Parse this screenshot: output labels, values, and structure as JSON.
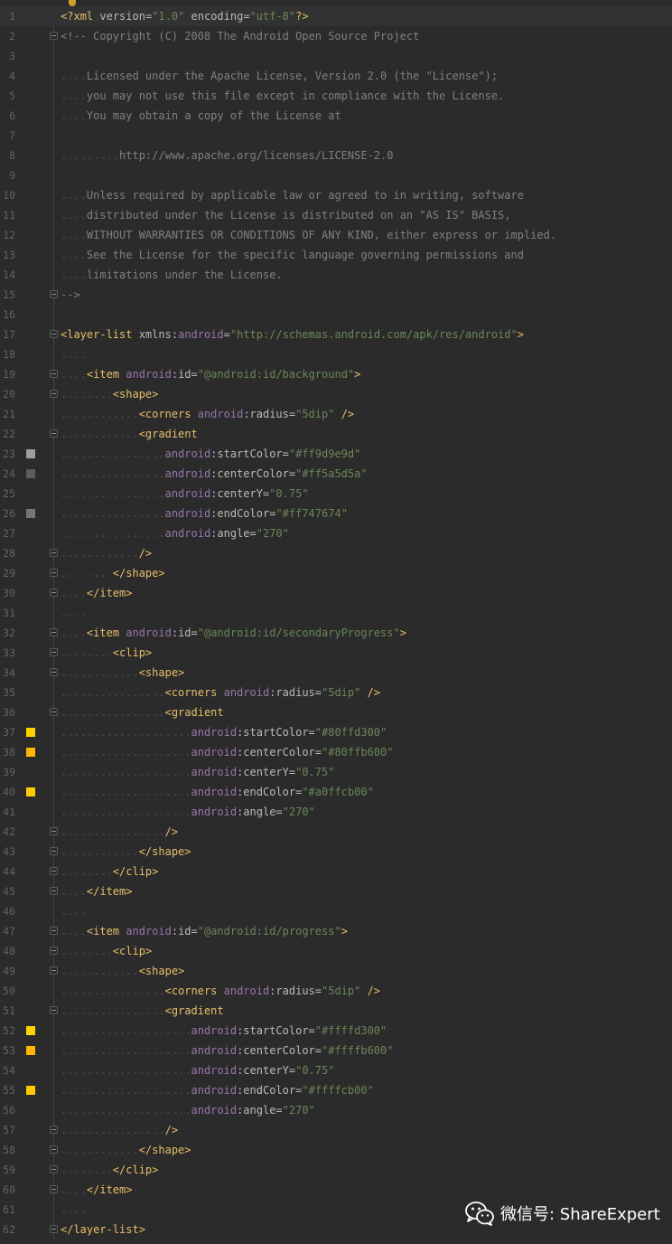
{
  "editor": {
    "swatch_colors": [
      "#9d9e9d",
      "#5a5d5a",
      "#747674",
      "#ffd300",
      "#ffb600",
      "#ffcb00"
    ],
    "lines": [
      {
        "no": "1",
        "segs": [
          [
            "pi",
            "<?"
          ],
          [
            "t",
            "xml"
          ],
          [
            "a",
            " version="
          ],
          [
            "s",
            "\"1.0\""
          ],
          [
            "a",
            " encoding="
          ],
          [
            "s",
            "\"utf-8\""
          ],
          [
            "pi",
            "?>"
          ]
        ]
      },
      {
        "no": "2",
        "fold": true,
        "segs": [
          [
            "c",
            "<!-- Copyright (C) 2008 The Android Open Source Project"
          ]
        ]
      },
      {
        "no": "3",
        "segs": []
      },
      {
        "no": "4",
        "segs": [
          [
            "d",
            "...."
          ],
          [
            "c",
            "Licensed under the Apache License, Version 2.0 (the \"License\");"
          ]
        ]
      },
      {
        "no": "5",
        "segs": [
          [
            "d",
            "...."
          ],
          [
            "c",
            "you may not use this file except in compliance with the License."
          ]
        ]
      },
      {
        "no": "6",
        "segs": [
          [
            "d",
            "...."
          ],
          [
            "c",
            "You may obtain a copy of the License at"
          ]
        ]
      },
      {
        "no": "7",
        "segs": []
      },
      {
        "no": "8",
        "segs": [
          [
            "d",
            "........."
          ],
          [
            "c",
            "http://www.apache.org/licenses/LICENSE-2.0"
          ]
        ]
      },
      {
        "no": "9",
        "segs": []
      },
      {
        "no": "10",
        "segs": [
          [
            "d",
            "...."
          ],
          [
            "c",
            "Unless required by applicable law or agreed to in writing, software"
          ]
        ]
      },
      {
        "no": "11",
        "segs": [
          [
            "d",
            "...."
          ],
          [
            "c",
            "distributed under the License is distributed on an \"AS IS\" BASIS,"
          ]
        ]
      },
      {
        "no": "12",
        "segs": [
          [
            "d",
            "...."
          ],
          [
            "c",
            "WITHOUT WARRANTIES OR CONDITIONS OF ANY KIND, either express or implied."
          ]
        ]
      },
      {
        "no": "13",
        "segs": [
          [
            "d",
            "...."
          ],
          [
            "c",
            "See the License for the specific language governing permissions and"
          ]
        ]
      },
      {
        "no": "14",
        "segs": [
          [
            "d",
            "...."
          ],
          [
            "c",
            "limitations under the License."
          ]
        ]
      },
      {
        "no": "15",
        "fold": true,
        "segs": [
          [
            "c",
            "-->"
          ]
        ]
      },
      {
        "no": "16",
        "segs": []
      },
      {
        "no": "17",
        "fold": true,
        "segs": [
          [
            "t",
            "<layer-list "
          ],
          [
            "a",
            "xmlns:"
          ],
          [
            "ns",
            "android"
          ],
          [
            "a",
            "="
          ],
          [
            "s",
            "\"http://schemas.android.com/apk/res/android\""
          ],
          [
            "t",
            ">"
          ]
        ]
      },
      {
        "no": "18",
        "segs": [
          [
            "d",
            "...."
          ]
        ]
      },
      {
        "no": "19",
        "fold": true,
        "segs": [
          [
            "d",
            "...."
          ],
          [
            "t",
            "<item "
          ],
          [
            "ns",
            "android"
          ],
          [
            "a",
            ":id="
          ],
          [
            "s",
            "\"@android:id/background\""
          ],
          [
            "t",
            ">"
          ]
        ]
      },
      {
        "no": "20",
        "fold": true,
        "segs": [
          [
            "d",
            "........"
          ],
          [
            "t",
            "<shape>"
          ]
        ]
      },
      {
        "no": "21",
        "segs": [
          [
            "d",
            "............"
          ],
          [
            "t",
            "<corners "
          ],
          [
            "ns",
            "android"
          ],
          [
            "a",
            ":radius="
          ],
          [
            "s",
            "\"5dip\""
          ],
          [
            "t",
            " />"
          ]
        ]
      },
      {
        "no": "22",
        "fold": true,
        "segs": [
          [
            "d",
            "............"
          ],
          [
            "t",
            "<gradient"
          ]
        ]
      },
      {
        "no": "23",
        "swatch": 0,
        "segs": [
          [
            "d",
            "................"
          ],
          [
            "ns",
            "android"
          ],
          [
            "a",
            ":startColor="
          ],
          [
            "s",
            "\"#ff9d9e9d\""
          ]
        ]
      },
      {
        "no": "24",
        "swatch": 1,
        "segs": [
          [
            "d",
            "................"
          ],
          [
            "ns",
            "android"
          ],
          [
            "a",
            ":centerColor="
          ],
          [
            "s",
            "\"#ff5a5d5a\""
          ]
        ]
      },
      {
        "no": "25",
        "segs": [
          [
            "d",
            "................"
          ],
          [
            "ns",
            "android"
          ],
          [
            "a",
            ":centerY="
          ],
          [
            "s",
            "\"0.75\""
          ]
        ]
      },
      {
        "no": "26",
        "swatch": 2,
        "segs": [
          [
            "d",
            "................"
          ],
          [
            "ns",
            "android"
          ],
          [
            "a",
            ":endColor="
          ],
          [
            "s",
            "\"#ff747674\""
          ]
        ]
      },
      {
        "no": "27",
        "segs": [
          [
            "d",
            "................"
          ],
          [
            "ns",
            "android"
          ],
          [
            "a",
            ":angle="
          ],
          [
            "s",
            "\"270\""
          ]
        ]
      },
      {
        "no": "28",
        "fold": true,
        "segs": [
          [
            "d",
            "............"
          ],
          [
            "t",
            "/>"
          ]
        ]
      },
      {
        "no": "29",
        "fold": true,
        "segs": [
          [
            "d",
            "........"
          ],
          [
            "t",
            "</shape>"
          ]
        ]
      },
      {
        "no": "30",
        "fold": true,
        "segs": [
          [
            "d",
            "...."
          ],
          [
            "t",
            "</item>"
          ]
        ]
      },
      {
        "no": "31",
        "segs": [
          [
            "d",
            "...."
          ]
        ]
      },
      {
        "no": "32",
        "fold": true,
        "segs": [
          [
            "d",
            "...."
          ],
          [
            "t",
            "<item "
          ],
          [
            "ns",
            "android"
          ],
          [
            "a",
            ":id="
          ],
          [
            "s",
            "\"@android:id/secondaryProgress\""
          ],
          [
            "t",
            ">"
          ]
        ]
      },
      {
        "no": "33",
        "fold": true,
        "segs": [
          [
            "d",
            "........"
          ],
          [
            "t",
            "<clip>"
          ]
        ]
      },
      {
        "no": "34",
        "fold": true,
        "segs": [
          [
            "d",
            "............"
          ],
          [
            "t",
            "<shape>"
          ]
        ]
      },
      {
        "no": "35",
        "segs": [
          [
            "d",
            "................"
          ],
          [
            "t",
            "<corners "
          ],
          [
            "ns",
            "android"
          ],
          [
            "a",
            ":radius="
          ],
          [
            "s",
            "\"5dip\""
          ],
          [
            "t",
            " />"
          ]
        ]
      },
      {
        "no": "36",
        "fold": true,
        "segs": [
          [
            "d",
            "................"
          ],
          [
            "t",
            "<gradient"
          ]
        ]
      },
      {
        "no": "37",
        "swatch": 3,
        "segs": [
          [
            "d",
            "...................."
          ],
          [
            "ns",
            "android"
          ],
          [
            "a",
            ":startColor="
          ],
          [
            "s",
            "\"#80ffd300\""
          ]
        ]
      },
      {
        "no": "38",
        "swatch": 4,
        "segs": [
          [
            "d",
            "...................."
          ],
          [
            "ns",
            "android"
          ],
          [
            "a",
            ":centerColor="
          ],
          [
            "s",
            "\"#80ffb600\""
          ]
        ]
      },
      {
        "no": "39",
        "segs": [
          [
            "d",
            "...................."
          ],
          [
            "ns",
            "android"
          ],
          [
            "a",
            ":centerY="
          ],
          [
            "s",
            "\"0.75\""
          ]
        ]
      },
      {
        "no": "40",
        "swatch": 5,
        "segs": [
          [
            "d",
            "...................."
          ],
          [
            "ns",
            "android"
          ],
          [
            "a",
            ":endColor="
          ],
          [
            "s",
            "\"#a0ffcb00\""
          ]
        ]
      },
      {
        "no": "41",
        "segs": [
          [
            "d",
            "...................."
          ],
          [
            "ns",
            "android"
          ],
          [
            "a",
            ":angle="
          ],
          [
            "s",
            "\"270\""
          ]
        ]
      },
      {
        "no": "42",
        "fold": true,
        "segs": [
          [
            "d",
            "................"
          ],
          [
            "t",
            "/>"
          ]
        ]
      },
      {
        "no": "43",
        "fold": true,
        "segs": [
          [
            "d",
            "............"
          ],
          [
            "t",
            "</shape>"
          ]
        ]
      },
      {
        "no": "44",
        "fold": true,
        "segs": [
          [
            "d",
            "........"
          ],
          [
            "t",
            "</clip>"
          ]
        ]
      },
      {
        "no": "45",
        "fold": true,
        "segs": [
          [
            "d",
            "...."
          ],
          [
            "t",
            "</item>"
          ]
        ]
      },
      {
        "no": "46",
        "segs": [
          [
            "d",
            "...."
          ]
        ]
      },
      {
        "no": "47",
        "fold": true,
        "segs": [
          [
            "d",
            "...."
          ],
          [
            "t",
            "<item "
          ],
          [
            "ns",
            "android"
          ],
          [
            "a",
            ":id="
          ],
          [
            "s",
            "\"@android:id/progress\""
          ],
          [
            "t",
            ">"
          ]
        ]
      },
      {
        "no": "48",
        "fold": true,
        "segs": [
          [
            "d",
            "........"
          ],
          [
            "t",
            "<clip>"
          ]
        ]
      },
      {
        "no": "49",
        "fold": true,
        "segs": [
          [
            "d",
            "............"
          ],
          [
            "t",
            "<shape>"
          ]
        ]
      },
      {
        "no": "50",
        "segs": [
          [
            "d",
            "................"
          ],
          [
            "t",
            "<corners "
          ],
          [
            "ns",
            "android"
          ],
          [
            "a",
            ":radius="
          ],
          [
            "s",
            "\"5dip\""
          ],
          [
            "t",
            " />"
          ]
        ]
      },
      {
        "no": "51",
        "fold": true,
        "segs": [
          [
            "d",
            "................"
          ],
          [
            "t",
            "<gradient"
          ]
        ]
      },
      {
        "no": "52",
        "swatch": 3,
        "segs": [
          [
            "d",
            "...................."
          ],
          [
            "ns",
            "android"
          ],
          [
            "a",
            ":startColor="
          ],
          [
            "s",
            "\"#ffffd300\""
          ]
        ]
      },
      {
        "no": "53",
        "swatch": 4,
        "segs": [
          [
            "d",
            "...................."
          ],
          [
            "ns",
            "android"
          ],
          [
            "a",
            ":centerColor="
          ],
          [
            "s",
            "\"#ffffb600\""
          ]
        ]
      },
      {
        "no": "54",
        "segs": [
          [
            "d",
            "...................."
          ],
          [
            "ns",
            "android"
          ],
          [
            "a",
            ":centerY="
          ],
          [
            "s",
            "\"0.75\""
          ]
        ]
      },
      {
        "no": "55",
        "swatch": 5,
        "segs": [
          [
            "d",
            "...................."
          ],
          [
            "ns",
            "android"
          ],
          [
            "a",
            ":endColor="
          ],
          [
            "s",
            "\"#ffffcb00\""
          ]
        ]
      },
      {
        "no": "56",
        "segs": [
          [
            "d",
            "...................."
          ],
          [
            "ns",
            "android"
          ],
          [
            "a",
            ":angle="
          ],
          [
            "s",
            "\"270\""
          ]
        ]
      },
      {
        "no": "57",
        "fold": true,
        "segs": [
          [
            "d",
            "................"
          ],
          [
            "t",
            "/>"
          ]
        ]
      },
      {
        "no": "58",
        "fold": true,
        "segs": [
          [
            "d",
            "............"
          ],
          [
            "t",
            "</shape>"
          ]
        ]
      },
      {
        "no": "59",
        "fold": true,
        "segs": [
          [
            "d",
            "........"
          ],
          [
            "t",
            "</clip>"
          ]
        ]
      },
      {
        "no": "60",
        "fold": true,
        "segs": [
          [
            "d",
            "...."
          ],
          [
            "t",
            "</item>"
          ]
        ]
      },
      {
        "no": "61",
        "segs": [
          [
            "d",
            "...."
          ]
        ]
      },
      {
        "no": "62",
        "fold": true,
        "segs": [
          [
            "t",
            "</layer-list>"
          ]
        ]
      }
    ]
  },
  "watermark": {
    "text": "微信号: ShareExpert",
    "icon": "wechat-icon"
  }
}
